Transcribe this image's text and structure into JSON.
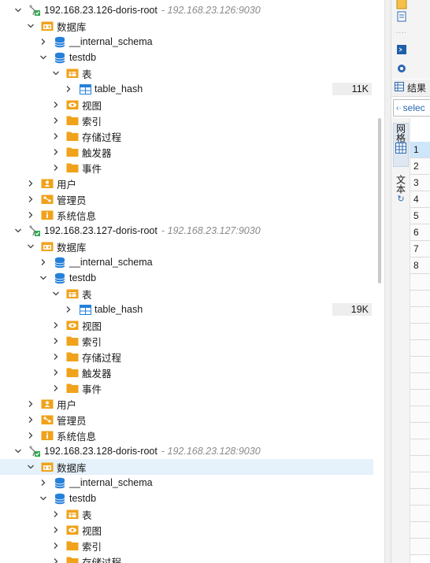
{
  "tree": {
    "connections": [
      {
        "name": "192.168.23.126-doris-root",
        "address": "192.168.23.126:9030",
        "folders": {
          "databases": "数据库",
          "users": "用户",
          "admins": "管理员",
          "sysinfo": "系统信息"
        },
        "dbs": [
          {
            "name": "__internal_schema"
          },
          {
            "name": "testdb",
            "tables_folder": "表",
            "tables": [
              {
                "name": "table_hash",
                "size": "11K"
              }
            ],
            "subfolders": [
              "视图",
              "索引",
              "存储过程",
              "触发器",
              "事件"
            ]
          }
        ]
      },
      {
        "name": "192.168.23.127-doris-root",
        "address": "192.168.23.127:9030",
        "folders": {
          "databases": "数据库",
          "users": "用户",
          "admins": "管理员",
          "sysinfo": "系统信息"
        },
        "dbs": [
          {
            "name": "__internal_schema"
          },
          {
            "name": "testdb",
            "tables_folder": "表",
            "tables": [
              {
                "name": "table_hash",
                "size": "19K"
              }
            ],
            "subfolders": [
              "视图",
              "索引",
              "存储过程",
              "触发器",
              "事件"
            ]
          }
        ]
      },
      {
        "name": "192.168.23.128-doris-root",
        "address": "192.168.23.128:9030",
        "folders": {
          "databases": "数据库"
        },
        "dbs": [
          {
            "name": "__internal_schema"
          },
          {
            "name": "testdb",
            "tables_folder": "表",
            "subfolders": [
              "视图",
              "索引",
              "存储过程"
            ]
          }
        ]
      }
    ]
  },
  "right_panel": {
    "toolbar_icons": [
      "edit-icon",
      "copy-icon",
      "console-icon",
      "settings-icon"
    ],
    "results_tab": "结果",
    "sql_preview": "selec",
    "side_tabs": [
      "网格",
      "文本"
    ],
    "row_numbers": [
      "1",
      "2",
      "3",
      "4",
      "5",
      "6",
      "7",
      "8"
    ]
  },
  "colors": {
    "folder": "#f0a21b",
    "db": "#2680d9",
    "selected_row": "#e5f1fb",
    "current_grid_row": "#cde6fa"
  }
}
